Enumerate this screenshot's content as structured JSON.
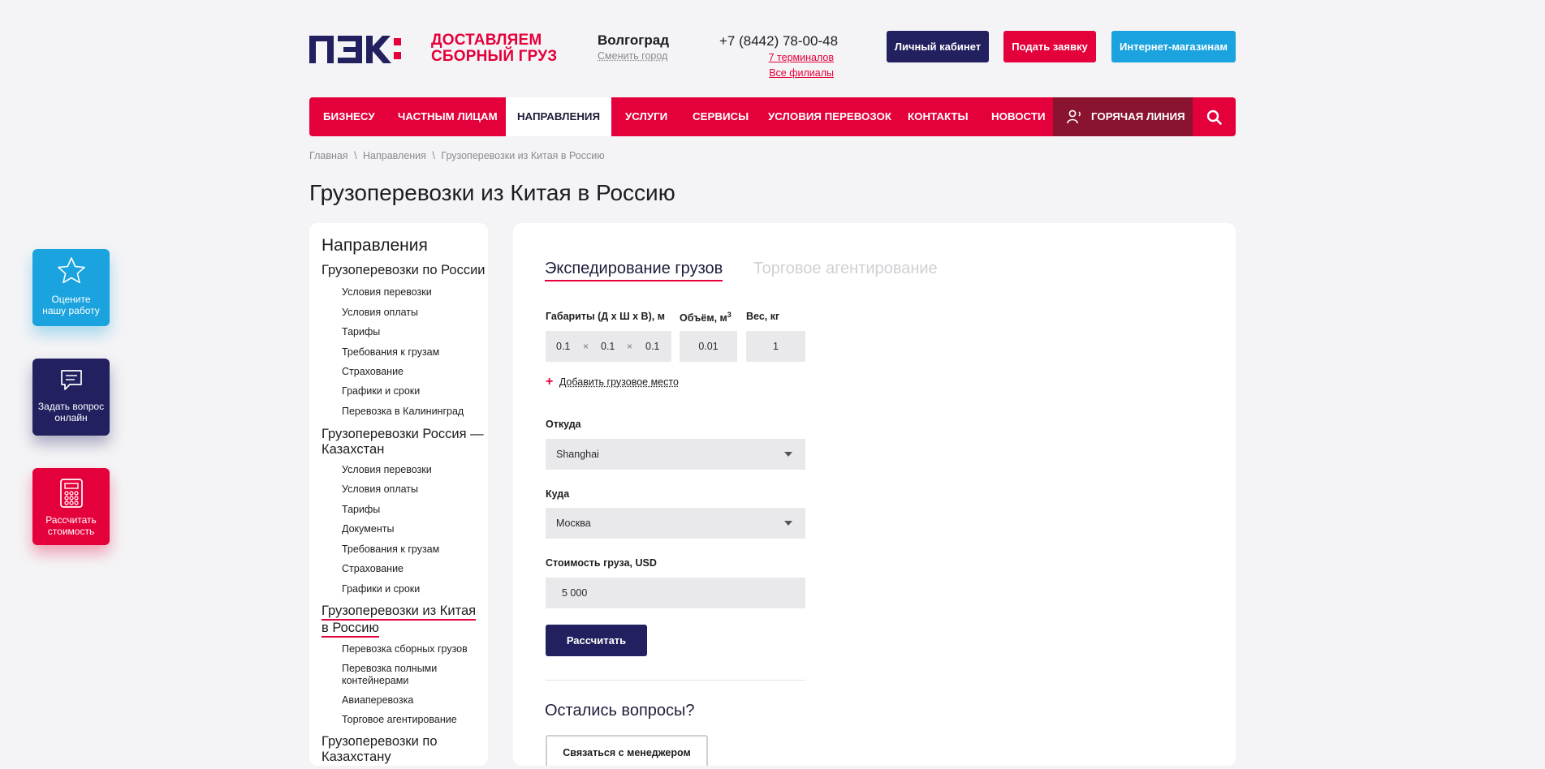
{
  "header": {
    "logo_mark": "ПЭК:",
    "logo_tagline_line1": "ДОСТАВЛЯЕМ",
    "logo_tagline_line2": "СБОРНЫЙ ГРУЗ",
    "city": "Волгоград",
    "change_city": "Сменить город",
    "phone": "+7 (8442) 78-00-48",
    "terminals": "7 терминалов",
    "all_branches": "Все филиалы",
    "btn_account": "Личный кабинет",
    "btn_request": "Подать заявку",
    "btn_shops": "Интернет-магазинам"
  },
  "nav": {
    "items": [
      "БИЗНЕСУ",
      "ЧАСТНЫМ ЛИЦАМ",
      "НАПРАВЛЕНИЯ",
      "УСЛУГИ",
      "СЕРВИСЫ",
      "УСЛОВИЯ ПЕРЕВОЗОК",
      "КОНТАКТЫ",
      "НОВОСТИ"
    ],
    "hotline": "ГОРЯЧАЯ ЛИНИЯ"
  },
  "breadcrumb": {
    "home": "Главная",
    "section": "Направления",
    "current": "Грузоперевозки из Китая в Россию",
    "sep": "\\"
  },
  "page_title": "Грузоперевозки из Китая в Россию",
  "sidebar": {
    "title": "Направления",
    "sec1": "Грузоперевозки по России",
    "sec1_items": [
      "Условия перевозки",
      "Условия оплаты",
      "Тарифы",
      "Требования к грузам",
      "Страхование",
      "Графики и сроки",
      "Перевозка в Калининград"
    ],
    "sec2_line1": "Грузоперевозки Россия —",
    "sec2_line2": "Казахстан",
    "sec2_items": [
      "Условия перевозки",
      "Условия оплаты",
      "Тарифы",
      "Документы",
      "Требования к грузам",
      "Страхование",
      "Графики и сроки"
    ],
    "sec3_line1": "Грузоперевозки из Китая",
    "sec3_line2": "в Россию",
    "sec3_item1": "Перевозка сборных грузов",
    "sec3_item2_line1": "Перевозка полными",
    "sec3_item2_line2": "контейнерами",
    "sec3_item3": "Авиаперевозка",
    "sec3_item4": "Торговое агентирование",
    "sec4_line1": "Грузоперевозки по",
    "sec4_line2": "Казахстану"
  },
  "calc": {
    "tab_active": "Экспедирование грузов",
    "tab_inactive": "Торговое агентирование",
    "label_dims": "Габариты (Д х Ш х В), м",
    "label_volume": "Объём, м",
    "label_volume_sup": "3",
    "label_weight": "Вес, кг",
    "dim_l": "0.1",
    "dim_w": "0.1",
    "dim_h": "0.1",
    "times": "×",
    "volume": "0.01",
    "weight": "1",
    "add_place_plus": "+",
    "add_place": "Добавить грузовое место",
    "label_from": "Откуда",
    "from_value": "Shanghai",
    "label_to": "Куда",
    "to_value": "Москва",
    "label_cost": "Стоимость груза, USD",
    "cost_value": "5 000",
    "btn_calc": "Рассчитать",
    "questions": "Остались вопросы?",
    "btn_contact": "Связаться с менеджером"
  },
  "floating": {
    "rate_line1": "Оцените",
    "rate_line2": "нашу работу",
    "ask_line1": "Задать вопрос",
    "ask_line2": "онлайн",
    "calc_line1": "Рассчитать",
    "calc_line2": "стоимость"
  },
  "colors": {
    "brand_red": "#e4003a",
    "brand_navy": "#22205f",
    "brand_blue": "#1aa3de"
  }
}
